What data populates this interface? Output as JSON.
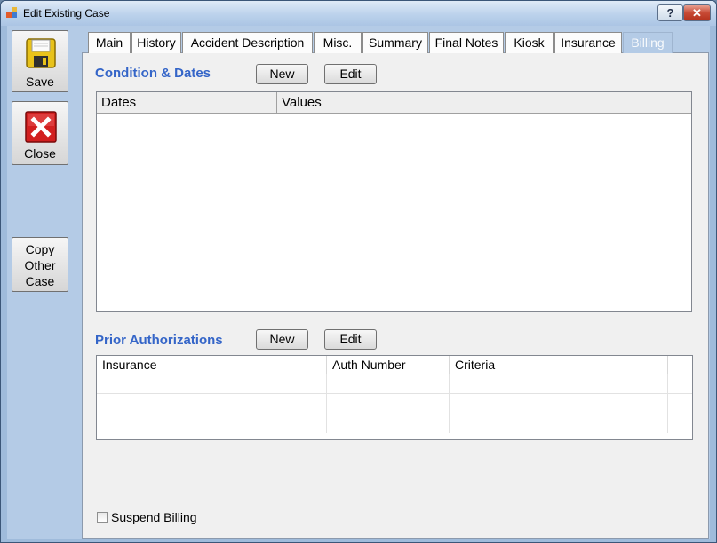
{
  "window": {
    "title": "Edit Existing Case",
    "help_label": "?",
    "close_label": "✕"
  },
  "sidebar": {
    "save_label": "Save",
    "close_label": "Close",
    "copy_label_lines": [
      "Copy",
      "Other",
      "Case"
    ]
  },
  "tabs": [
    "Main",
    "History",
    "Accident Description",
    "Misc.",
    "Summary",
    "Final Notes",
    "Kiosk",
    "Insurance",
    "Billing"
  ],
  "active_tab": "Billing",
  "conditions": {
    "title": "Condition & Dates",
    "new_label": "New",
    "edit_label": "Edit",
    "columns": [
      "Dates",
      "Values"
    ]
  },
  "prior_auth": {
    "title": "Prior Authorizations",
    "new_label": "New",
    "edit_label": "Edit",
    "columns": [
      "Insurance",
      "Auth Number",
      "Criteria"
    ]
  },
  "suspend_billing": {
    "label": "Suspend Billing",
    "checked": false
  },
  "colors": {
    "accent": "#3465c8",
    "frame": "#b4cbe6",
    "panel": "#f0f0f0"
  }
}
